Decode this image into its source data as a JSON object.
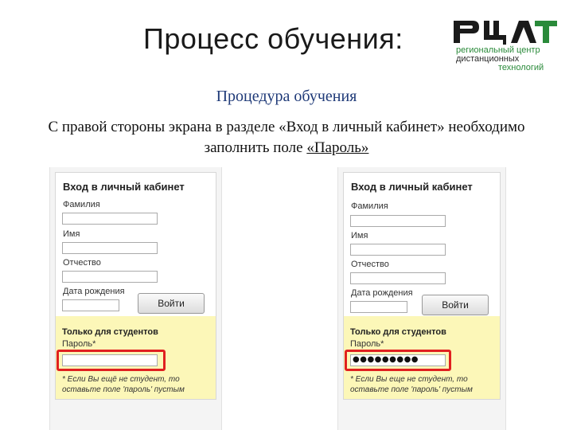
{
  "slide": {
    "title": "Процесс обучения:",
    "subtitle": "Процедура обучения",
    "instruction_before": "С правой стороны экрана в разделе «Вход в личный кабинет» необходимо заполнить поле ",
    "instruction_highlight": "«Пароль»"
  },
  "logo": {
    "mark": "РЦДТ",
    "line1": "региональный центр",
    "line2": "дистанционных",
    "line3": "технологий",
    "color_green": "#2a8a3a"
  },
  "forms": [
    {
      "title": "Вход в личный кабинет",
      "surname_label": "Фамилия",
      "name_label": "Имя",
      "patronymic_label": "Отчество",
      "birthdate_label": "Дата рождения",
      "login_button": "Войти",
      "students_title": "Только для студентов",
      "password_label": "Пароль*",
      "password_value": "",
      "note": "* Если Вы ещё не студент, то оставьте поле 'пароль' пустым"
    },
    {
      "title": "Вход в личный кабинет",
      "surname_label": "Фамилия",
      "name_label": "Имя",
      "patronymic_label": "Отчество",
      "birthdate_label": "Дата рождения",
      "login_button": "Войти",
      "students_title": "Только для студентов",
      "password_label": "Пароль*",
      "password_value": "●●●●●●●●●",
      "note": "* Если Вы еще не студент, то оставьте поле 'пароль' пустым"
    }
  ],
  "colors": {
    "highlight": "#e02020",
    "students_bg": "#fcf7b8",
    "subtitle": "#1f3a78"
  }
}
